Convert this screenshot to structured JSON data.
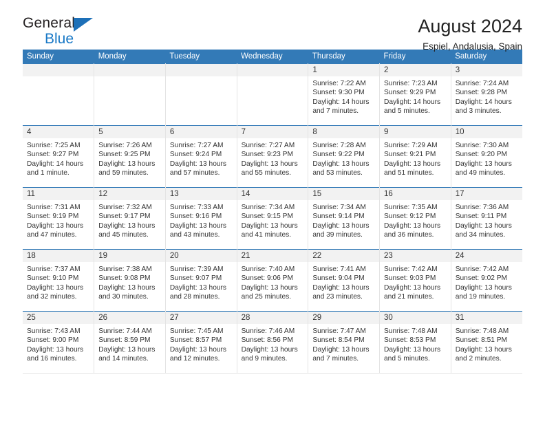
{
  "brand": {
    "name_top": "General",
    "name_bottom": "Blue",
    "triangle_color": "#1d70b8",
    "blue_color": "#1878c6"
  },
  "header": {
    "title": "August 2024",
    "subtitle": "Espiel, Andalusia, Spain"
  },
  "theme": {
    "header_blue": "#337ab7",
    "daynum_band": "#f2f2f2",
    "grid_line": "#e4e4e4",
    "text": "#333333"
  },
  "weekdays": [
    "Sunday",
    "Monday",
    "Tuesday",
    "Wednesday",
    "Thursday",
    "Friday",
    "Saturday"
  ],
  "labels": {
    "sunrise_prefix": "Sunrise: ",
    "sunset_prefix": "Sunset: ",
    "daylight_prefix": "Daylight: "
  },
  "weeks": [
    [
      {
        "empty": true
      },
      {
        "empty": true
      },
      {
        "empty": true
      },
      {
        "empty": true
      },
      {
        "day": "1",
        "sunrise": "Sunrise: 7:22 AM",
        "sunset": "Sunset: 9:30 PM",
        "daylight_1": "Daylight: 14 hours",
        "daylight_2": "and 7 minutes."
      },
      {
        "day": "2",
        "sunrise": "Sunrise: 7:23 AM",
        "sunset": "Sunset: 9:29 PM",
        "daylight_1": "Daylight: 14 hours",
        "daylight_2": "and 5 minutes."
      },
      {
        "day": "3",
        "sunrise": "Sunrise: 7:24 AM",
        "sunset": "Sunset: 9:28 PM",
        "daylight_1": "Daylight: 14 hours",
        "daylight_2": "and 3 minutes."
      }
    ],
    [
      {
        "day": "4",
        "sunrise": "Sunrise: 7:25 AM",
        "sunset": "Sunset: 9:27 PM",
        "daylight_1": "Daylight: 14 hours",
        "daylight_2": "and 1 minute."
      },
      {
        "day": "5",
        "sunrise": "Sunrise: 7:26 AM",
        "sunset": "Sunset: 9:25 PM",
        "daylight_1": "Daylight: 13 hours",
        "daylight_2": "and 59 minutes."
      },
      {
        "day": "6",
        "sunrise": "Sunrise: 7:27 AM",
        "sunset": "Sunset: 9:24 PM",
        "daylight_1": "Daylight: 13 hours",
        "daylight_2": "and 57 minutes."
      },
      {
        "day": "7",
        "sunrise": "Sunrise: 7:27 AM",
        "sunset": "Sunset: 9:23 PM",
        "daylight_1": "Daylight: 13 hours",
        "daylight_2": "and 55 minutes."
      },
      {
        "day": "8",
        "sunrise": "Sunrise: 7:28 AM",
        "sunset": "Sunset: 9:22 PM",
        "daylight_1": "Daylight: 13 hours",
        "daylight_2": "and 53 minutes."
      },
      {
        "day": "9",
        "sunrise": "Sunrise: 7:29 AM",
        "sunset": "Sunset: 9:21 PM",
        "daylight_1": "Daylight: 13 hours",
        "daylight_2": "and 51 minutes."
      },
      {
        "day": "10",
        "sunrise": "Sunrise: 7:30 AM",
        "sunset": "Sunset: 9:20 PM",
        "daylight_1": "Daylight: 13 hours",
        "daylight_2": "and 49 minutes."
      }
    ],
    [
      {
        "day": "11",
        "sunrise": "Sunrise: 7:31 AM",
        "sunset": "Sunset: 9:19 PM",
        "daylight_1": "Daylight: 13 hours",
        "daylight_2": "and 47 minutes."
      },
      {
        "day": "12",
        "sunrise": "Sunrise: 7:32 AM",
        "sunset": "Sunset: 9:17 PM",
        "daylight_1": "Daylight: 13 hours",
        "daylight_2": "and 45 minutes."
      },
      {
        "day": "13",
        "sunrise": "Sunrise: 7:33 AM",
        "sunset": "Sunset: 9:16 PM",
        "daylight_1": "Daylight: 13 hours",
        "daylight_2": "and 43 minutes."
      },
      {
        "day": "14",
        "sunrise": "Sunrise: 7:34 AM",
        "sunset": "Sunset: 9:15 PM",
        "daylight_1": "Daylight: 13 hours",
        "daylight_2": "and 41 minutes."
      },
      {
        "day": "15",
        "sunrise": "Sunrise: 7:34 AM",
        "sunset": "Sunset: 9:14 PM",
        "daylight_1": "Daylight: 13 hours",
        "daylight_2": "and 39 minutes."
      },
      {
        "day": "16",
        "sunrise": "Sunrise: 7:35 AM",
        "sunset": "Sunset: 9:12 PM",
        "daylight_1": "Daylight: 13 hours",
        "daylight_2": "and 36 minutes."
      },
      {
        "day": "17",
        "sunrise": "Sunrise: 7:36 AM",
        "sunset": "Sunset: 9:11 PM",
        "daylight_1": "Daylight: 13 hours",
        "daylight_2": "and 34 minutes."
      }
    ],
    [
      {
        "day": "18",
        "sunrise": "Sunrise: 7:37 AM",
        "sunset": "Sunset: 9:10 PM",
        "daylight_1": "Daylight: 13 hours",
        "daylight_2": "and 32 minutes."
      },
      {
        "day": "19",
        "sunrise": "Sunrise: 7:38 AM",
        "sunset": "Sunset: 9:08 PM",
        "daylight_1": "Daylight: 13 hours",
        "daylight_2": "and 30 minutes."
      },
      {
        "day": "20",
        "sunrise": "Sunrise: 7:39 AM",
        "sunset": "Sunset: 9:07 PM",
        "daylight_1": "Daylight: 13 hours",
        "daylight_2": "and 28 minutes."
      },
      {
        "day": "21",
        "sunrise": "Sunrise: 7:40 AM",
        "sunset": "Sunset: 9:06 PM",
        "daylight_1": "Daylight: 13 hours",
        "daylight_2": "and 25 minutes."
      },
      {
        "day": "22",
        "sunrise": "Sunrise: 7:41 AM",
        "sunset": "Sunset: 9:04 PM",
        "daylight_1": "Daylight: 13 hours",
        "daylight_2": "and 23 minutes."
      },
      {
        "day": "23",
        "sunrise": "Sunrise: 7:42 AM",
        "sunset": "Sunset: 9:03 PM",
        "daylight_1": "Daylight: 13 hours",
        "daylight_2": "and 21 minutes."
      },
      {
        "day": "24",
        "sunrise": "Sunrise: 7:42 AM",
        "sunset": "Sunset: 9:02 PM",
        "daylight_1": "Daylight: 13 hours",
        "daylight_2": "and 19 minutes."
      }
    ],
    [
      {
        "day": "25",
        "sunrise": "Sunrise: 7:43 AM",
        "sunset": "Sunset: 9:00 PM",
        "daylight_1": "Daylight: 13 hours",
        "daylight_2": "and 16 minutes."
      },
      {
        "day": "26",
        "sunrise": "Sunrise: 7:44 AM",
        "sunset": "Sunset: 8:59 PM",
        "daylight_1": "Daylight: 13 hours",
        "daylight_2": "and 14 minutes."
      },
      {
        "day": "27",
        "sunrise": "Sunrise: 7:45 AM",
        "sunset": "Sunset: 8:57 PM",
        "daylight_1": "Daylight: 13 hours",
        "daylight_2": "and 12 minutes."
      },
      {
        "day": "28",
        "sunrise": "Sunrise: 7:46 AM",
        "sunset": "Sunset: 8:56 PM",
        "daylight_1": "Daylight: 13 hours",
        "daylight_2": "and 9 minutes."
      },
      {
        "day": "29",
        "sunrise": "Sunrise: 7:47 AM",
        "sunset": "Sunset: 8:54 PM",
        "daylight_1": "Daylight: 13 hours",
        "daylight_2": "and 7 minutes."
      },
      {
        "day": "30",
        "sunrise": "Sunrise: 7:48 AM",
        "sunset": "Sunset: 8:53 PM",
        "daylight_1": "Daylight: 13 hours",
        "daylight_2": "and 5 minutes."
      },
      {
        "day": "31",
        "sunrise": "Sunrise: 7:48 AM",
        "sunset": "Sunset: 8:51 PM",
        "daylight_1": "Daylight: 13 hours",
        "daylight_2": "and 2 minutes."
      }
    ]
  ]
}
